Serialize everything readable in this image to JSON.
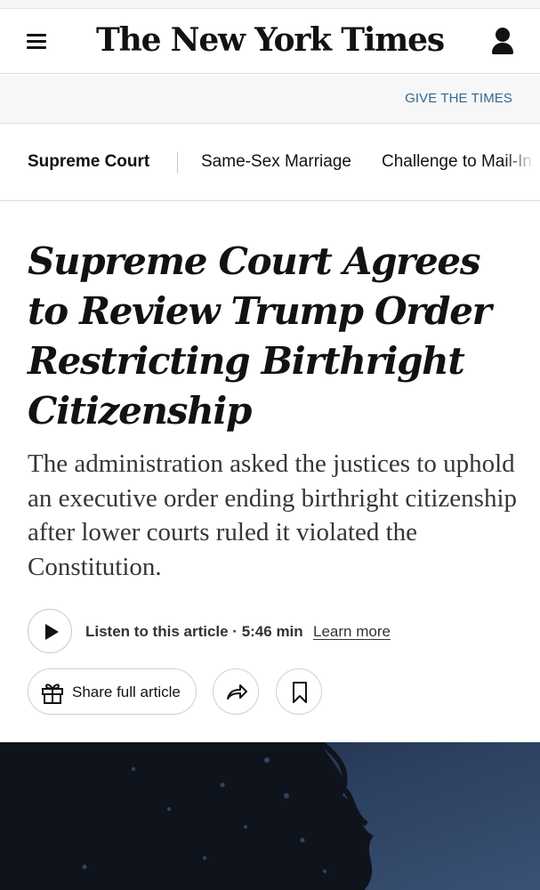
{
  "masthead": {
    "logo": "The New York Times",
    "menu_icon": "hamburger-menu-icon",
    "account_icon": "user-account-icon"
  },
  "promo": {
    "link_label": "GIVE THE TIMES",
    "color": "#326891"
  },
  "subnav": {
    "items": [
      {
        "label": "Supreme Court"
      },
      {
        "label": "Same-Sex Marriage"
      },
      {
        "label": "Challenge to Mail-In"
      }
    ]
  },
  "article": {
    "headline": "Supreme Court Agrees to Review Trump Order Restricting Birthright Citizenship",
    "summary": "The administration asked the justices to uphold an executive order ending birthright citizenship after lower courts ruled it violated the Constitution.",
    "audio": {
      "play_icon": "play-icon",
      "listen_label": "Listen to this article · 5:46 min",
      "learn_more": "Learn more"
    },
    "actions": {
      "share_label": "Share full article",
      "gift_icon": "gift-icon",
      "share_icon": "share-arrow-icon",
      "bookmark_icon": "bookmark-icon"
    }
  }
}
